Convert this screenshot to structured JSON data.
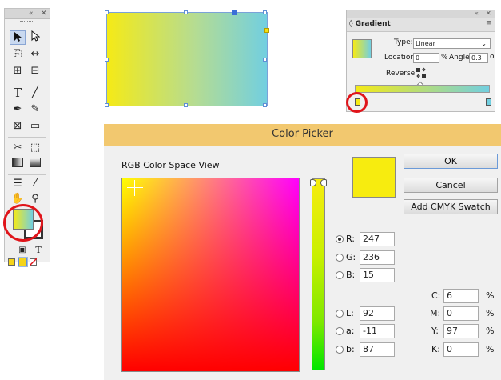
{
  "tools_panel": {
    "collapse_label": "«",
    "close_label": "✕"
  },
  "gradient_panel": {
    "collapse_label": "«",
    "close_label": "✕",
    "title": "◊ Gradient",
    "type_label": "Type:",
    "type_value": "Linear",
    "location_label": "Location:",
    "location_value": "0",
    "location_unit": "%",
    "angle_label": "Angle:",
    "angle_value": "0.3",
    "angle_unit": "o",
    "reverse_label": "Reverse",
    "gradient_colors": {
      "start": "#f5ea16",
      "end": "#72cfe0"
    }
  },
  "color_picker": {
    "title": "Color Picker",
    "view_label": "RGB Color Space View",
    "ok_label": "OK",
    "cancel_label": "Cancel",
    "add_swatch_label": "Add CMYK Swatch",
    "preview_color": "#f7ec0f",
    "rgb": [
      {
        "label": "R:",
        "value": "247",
        "selected": true
      },
      {
        "label": "G:",
        "value": "236",
        "selected": false
      },
      {
        "label": "B:",
        "value": "15",
        "selected": false
      }
    ],
    "lab": [
      {
        "label": "L:",
        "value": "92"
      },
      {
        "label": "a:",
        "value": "-11"
      },
      {
        "label": "b:",
        "value": "87"
      }
    ],
    "cmyk": [
      {
        "label": "C:",
        "value": "6",
        "unit": "%"
      },
      {
        "label": "M:",
        "value": "0",
        "unit": "%"
      },
      {
        "label": "Y:",
        "value": "97",
        "unit": "%"
      },
      {
        "label": "K:",
        "value": "0",
        "unit": "%"
      }
    ]
  },
  "highlight_color": "#e0141a"
}
